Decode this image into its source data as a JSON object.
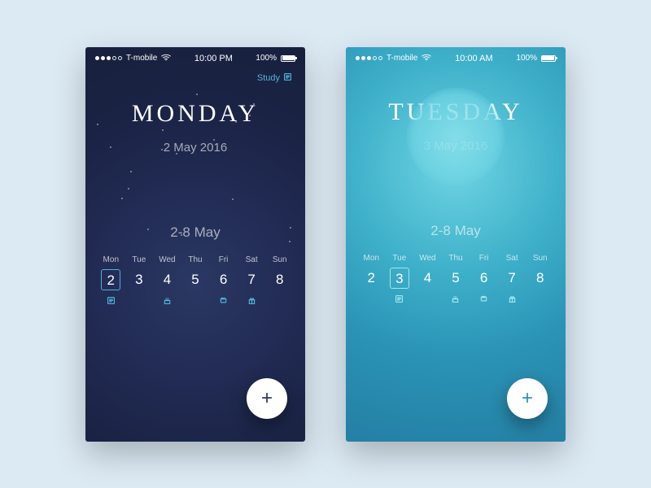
{
  "screens": [
    {
      "key": "left",
      "theme": "night",
      "statusbar": {
        "carrier": "T-mobile",
        "time": "10:00 PM",
        "batteryLabel": "100%"
      },
      "tag": {
        "visible": true,
        "label": "Study"
      },
      "dayName": "MONDAY",
      "dateLine": "2 May 2016",
      "weekRange": "2-8 May",
      "weekdays": [
        "Mon",
        "Tue",
        "Wed",
        "Thu",
        "Fri",
        "Sat",
        "Sun"
      ],
      "dates": [
        {
          "num": "2",
          "selected": true,
          "icon": "note"
        },
        {
          "num": "3",
          "selected": false,
          "icon": null
        },
        {
          "num": "4",
          "selected": false,
          "icon": "cake"
        },
        {
          "num": "5",
          "selected": false,
          "icon": null
        },
        {
          "num": "6",
          "selected": false,
          "icon": "film"
        },
        {
          "num": "7",
          "selected": false,
          "icon": "gift"
        },
        {
          "num": "8",
          "selected": false,
          "icon": null
        }
      ]
    },
    {
      "key": "right",
      "theme": "day",
      "statusbar": {
        "carrier": "T-mobile",
        "time": "10:00 AM",
        "batteryLabel": "100%"
      },
      "tag": {
        "visible": false,
        "label": ""
      },
      "dayName": "TUESDAY",
      "dateLine": "3 May 2016",
      "weekRange": "2-8 May",
      "weekdays": [
        "Mon",
        "Tue",
        "Wed",
        "Thu",
        "Fri",
        "Sat",
        "Sun"
      ],
      "dates": [
        {
          "num": "2",
          "selected": false,
          "icon": null
        },
        {
          "num": "3",
          "selected": true,
          "icon": "note"
        },
        {
          "num": "4",
          "selected": false,
          "icon": null
        },
        {
          "num": "5",
          "selected": false,
          "icon": "cake"
        },
        {
          "num": "6",
          "selected": false,
          "icon": "film"
        },
        {
          "num": "7",
          "selected": false,
          "icon": "gift"
        },
        {
          "num": "8",
          "selected": false,
          "icon": null
        }
      ]
    }
  ],
  "fabLabel": "+"
}
